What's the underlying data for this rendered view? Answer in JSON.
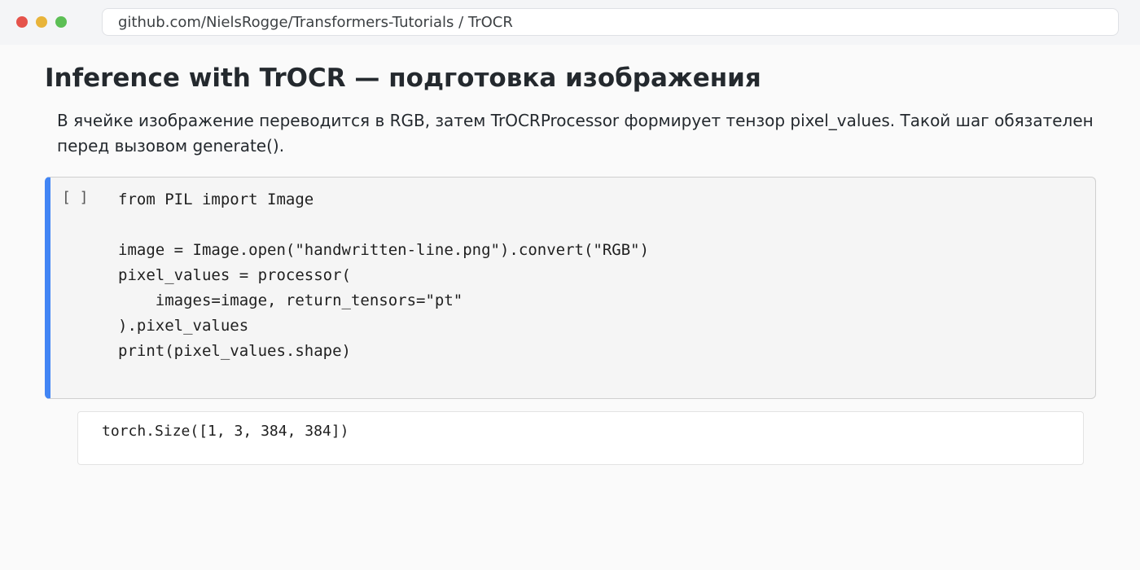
{
  "browser": {
    "url": "github.com/NielsRogge/Transformers-Tutorials / TrOCR"
  },
  "notebook": {
    "title": "Inference with TrOCR — подготовка изображения",
    "description": "В ячейке изображение переводится в RGB, затем TrOCRProcessor формирует тензор pixel_values. Такой шаг обязателен перед вызовом generate().",
    "code_cell": {
      "execution_count": "[ ]",
      "code": "from PIL import Image\n\nimage = Image.open(\"handwritten-line.png\").convert(\"RGB\")\npixel_values = processor(\n    images=image, return_tensors=\"pt\"\n).pixel_values\nprint(pixel_values.shape)"
    },
    "output": {
      "text": "torch.Size([1, 3, 384, 384])"
    }
  },
  "colors": {
    "cell_accent": "#4285f4",
    "close": "#e5534b",
    "minimize": "#e8b43a",
    "maximize": "#5cbf55"
  }
}
